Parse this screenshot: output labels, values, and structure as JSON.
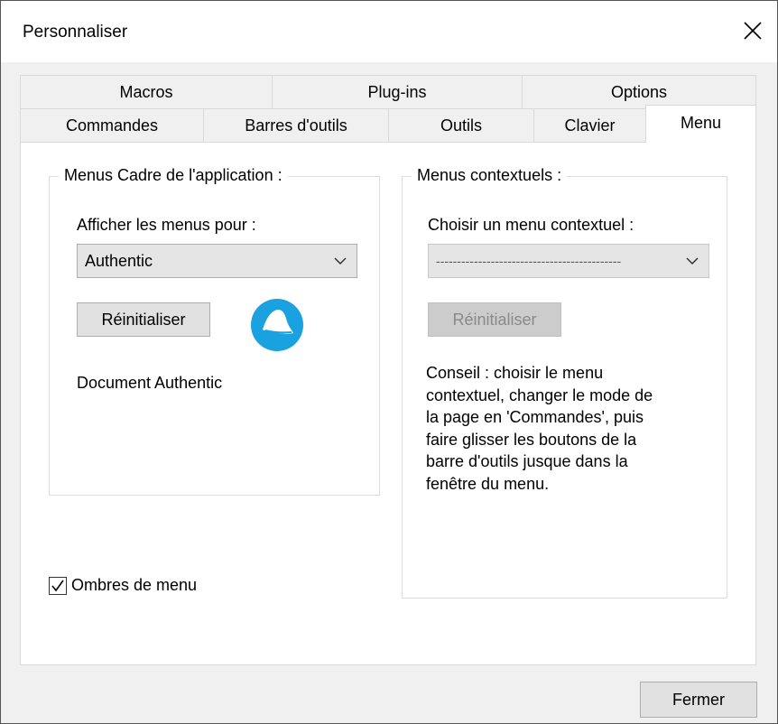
{
  "window": {
    "title": "Personnaliser",
    "close_label": "Fermer"
  },
  "tabs_row1": [
    {
      "label": "Macros"
    },
    {
      "label": "Plug-ins"
    },
    {
      "label": "Options"
    }
  ],
  "tabs_row2": [
    {
      "label": "Commandes"
    },
    {
      "label": "Barres d'outils"
    },
    {
      "label": "Outils"
    },
    {
      "label": "Clavier"
    },
    {
      "label": "Menu",
      "active": true
    }
  ],
  "app_menus": {
    "legend": "Menus Cadre de l'application :",
    "show_for_label": "Afficher les menus pour :",
    "selected": "Authentic",
    "reset_label": "Réinitialiser",
    "document_label": "Document Authentic",
    "logo_icon": "authentic-logo-icon"
  },
  "context_menus": {
    "legend": "Menus contextuels :",
    "choose_label": "Choisir un menu contextuel :",
    "selected": "--------------------------------------------",
    "reset_label": "Réinitialiser",
    "tip": "Conseil : choisir le menu\ncontextuel, changer le mode de\nla page en 'Commandes', puis\nfaire glisser les boutons de la\nbarre d'outils jusque dans la\nfenêtre du menu."
  },
  "menu_shadows": {
    "label": "Ombres de menu",
    "checked": true
  },
  "colors": {
    "logo_blue": "#1aa1e0",
    "panel": "#ffffff",
    "dialog": "#f0f0f0"
  }
}
